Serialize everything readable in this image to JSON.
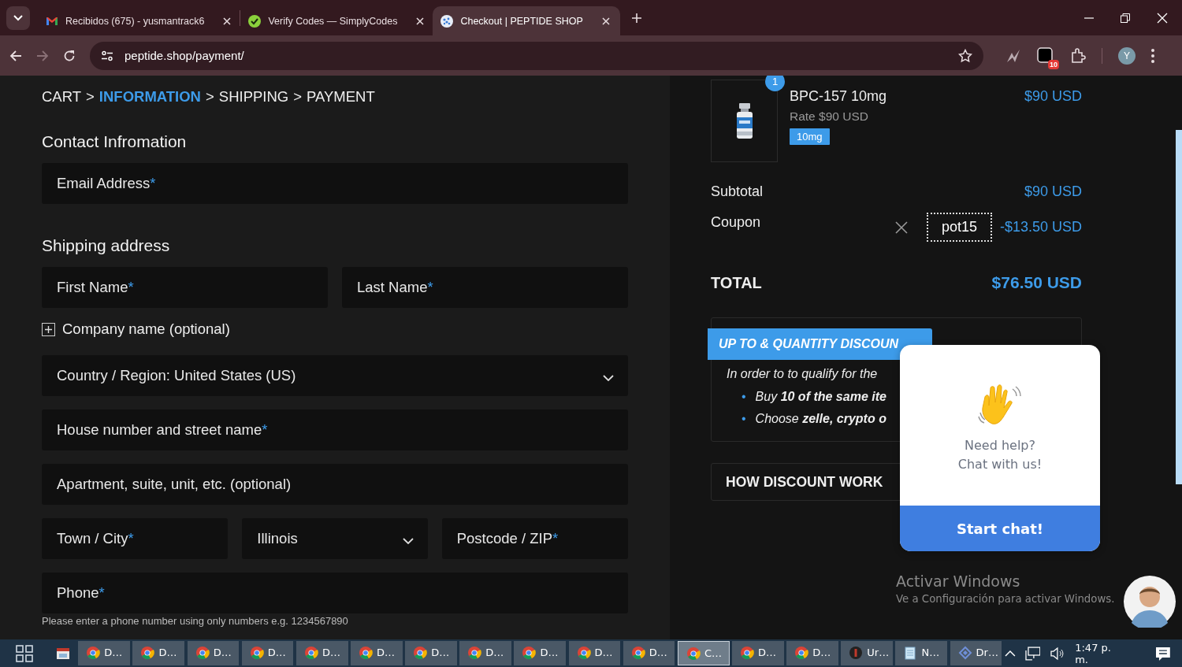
{
  "browser": {
    "tabs": [
      {
        "title": "Recibidos (675) - yusmantrack6",
        "selected": false
      },
      {
        "title": "Verify Codes — SimplyCodes",
        "selected": false
      },
      {
        "title": "Checkout | PEPTIDE SHOP",
        "selected": true
      }
    ],
    "url": "peptide.shop/payment/",
    "extension_badge": "10",
    "profile_initial": "Y"
  },
  "breadcrumb": [
    {
      "kind": "step",
      "label": "CART",
      "selected": false
    },
    {
      "kind": "separator",
      "label": ">"
    },
    {
      "kind": "step",
      "label": "INFORMATION",
      "selected": true
    },
    {
      "kind": "separator",
      "label": ">"
    },
    {
      "kind": "step",
      "label": "SHIPPING",
      "selected": false
    },
    {
      "kind": "separator",
      "label": ">"
    },
    {
      "kind": "step",
      "label": "PAYMENT",
      "selected": false
    }
  ],
  "contact": {
    "heading": "Contact Infromation",
    "fields": [
      {
        "kind": "input",
        "placeholder": "Email Address",
        "required_mark": "*"
      }
    ]
  },
  "shipping": {
    "heading": "Shipping address",
    "rows": [
      [
        {
          "kind": "input",
          "placeholder": "First Name",
          "required_mark": "*"
        },
        {
          "kind": "input",
          "placeholder": "Last Name",
          "required_mark": "*"
        }
      ],
      [
        {
          "kind": "toggle",
          "label": "Company name (optional)",
          "expanded": false
        }
      ],
      [
        {
          "kind": "select",
          "value": "Country / Region: United States (US)"
        }
      ],
      [
        {
          "kind": "input",
          "placeholder": "House number and street name",
          "required_mark": "*"
        }
      ],
      [
        {
          "kind": "input",
          "placeholder": "Apartment, suite, unit, etc. (optional)"
        }
      ],
      [
        {
          "kind": "input",
          "placeholder": "Town / City",
          "required_mark": "*"
        },
        {
          "kind": "select",
          "value": "Illinois"
        },
        {
          "kind": "input",
          "placeholder": "Postcode / ZIP",
          "required_mark": "*"
        }
      ],
      [
        {
          "kind": "input",
          "placeholder": "Phone",
          "required_mark": "*"
        }
      ],
      [
        {
          "kind": "hint",
          "text": "Please enter a phone number using only numbers e.g. 1234567890"
        }
      ]
    ]
  },
  "order": {
    "items": [
      {
        "quantity": "1",
        "name": "BPC-157 10mg",
        "price": "$90 USD",
        "rate": "Rate $90 USD",
        "variant": "10mg"
      }
    ],
    "subtotal": {
      "label": "Subtotal",
      "value": "$90 USD"
    },
    "coupon": {
      "label": "Coupon",
      "code": "pot15",
      "value": "-$13.50 USD"
    },
    "total": {
      "label": "TOTAL",
      "value": "$76.50 USD"
    }
  },
  "discount": {
    "title": "UP TO & QUANTITY DISCOUN",
    "intro": "In order to to qualify for the",
    "bullets": [
      {
        "marker": "•",
        "text": "Buy **10 of the same ite**"
      },
      {
        "marker": "•",
        "text": "Choose **zelle, crypto o**"
      }
    ],
    "how_title": "HOW DISCOUNT WORK"
  },
  "chat": {
    "lines": [
      "Need help?",
      "Chat with us!"
    ],
    "button": "Start chat!"
  },
  "windows_notice": {
    "title": "Activar Windows",
    "text": "Ve a Configuración para activar Windows."
  },
  "taskbar": {
    "items": [
      {
        "kind": "chrome",
        "label": "D…",
        "selected": false
      },
      {
        "kind": "chrome",
        "label": "D…",
        "selected": false
      },
      {
        "kind": "chrome",
        "label": "D…",
        "selected": false
      },
      {
        "kind": "chrome",
        "label": "D…",
        "selected": false
      },
      {
        "kind": "chrome",
        "label": "D…",
        "selected": false
      },
      {
        "kind": "chrome",
        "label": "D…",
        "selected": false
      },
      {
        "kind": "chrome",
        "label": "D…",
        "selected": false
      },
      {
        "kind": "chrome",
        "label": "D…",
        "selected": false
      },
      {
        "kind": "chrome",
        "label": "D…",
        "selected": false
      },
      {
        "kind": "chrome",
        "label": "D…",
        "selected": false
      },
      {
        "kind": "chrome",
        "label": "D…",
        "selected": false
      },
      {
        "kind": "chrome",
        "label": "C…",
        "selected": true
      },
      {
        "kind": "chrome",
        "label": "D…",
        "selected": false
      },
      {
        "kind": "chrome",
        "label": "D…",
        "selected": false
      },
      {
        "kind": "app",
        "label": "Ur…",
        "selected": false
      },
      {
        "kind": "notepad",
        "label": "N…",
        "selected": false
      },
      {
        "kind": "network",
        "label": "Dr…",
        "selected": false
      }
    ],
    "time": "1:47 p. m."
  }
}
